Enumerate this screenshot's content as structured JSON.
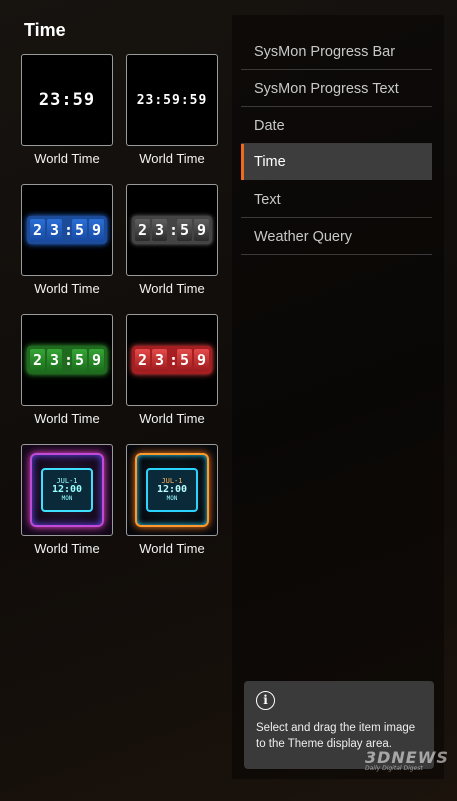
{
  "panel": {
    "title": "Time"
  },
  "items": [
    {
      "caption": "World Time",
      "clock": "23:59",
      "style": "plain-large"
    },
    {
      "caption": "World Time",
      "clock": "23:59:59",
      "style": "plain-small"
    },
    {
      "caption": "World Time",
      "clock_digits": [
        "2",
        "3",
        ":",
        "5",
        "9"
      ],
      "style": "flip-blue",
      "color": "#2b6fd6"
    },
    {
      "caption": "World Time",
      "clock_digits": [
        "2",
        "3",
        ":",
        "5",
        "9"
      ],
      "style": "flip-gray",
      "color": "#5e5e5e"
    },
    {
      "caption": "World Time",
      "clock_digits": [
        "2",
        "3",
        ":",
        "5",
        "9"
      ],
      "style": "flip-green",
      "color": "#35a535"
    },
    {
      "caption": "World Time",
      "clock_digits": [
        "2",
        "3",
        ":",
        "5",
        "9"
      ],
      "style": "flip-red",
      "color": "#e34a4a"
    },
    {
      "caption": "World Time",
      "date": "JUL-1",
      "time": "12:00",
      "day": "MON",
      "style": "neon-pink"
    },
    {
      "caption": "World Time",
      "date": "JUL-1",
      "time": "12:00",
      "day": "MON",
      "style": "neon-orange"
    }
  ],
  "menu": [
    {
      "label": "SysMon Progress Bar"
    },
    {
      "label": "SysMon Progress Text"
    },
    {
      "label": "Date"
    },
    {
      "label": "Time",
      "active": true
    },
    {
      "label": "Text"
    },
    {
      "label": "Weather Query"
    }
  ],
  "info": {
    "icon": "info-icon",
    "text": "Select and drag the item image to the Theme display area."
  },
  "watermark": {
    "line1": "3DNEWS",
    "line2": "Daily Digital Digest"
  },
  "colors": {
    "accent": "#ef6a1f",
    "active_bg": "#3d3d3d"
  }
}
